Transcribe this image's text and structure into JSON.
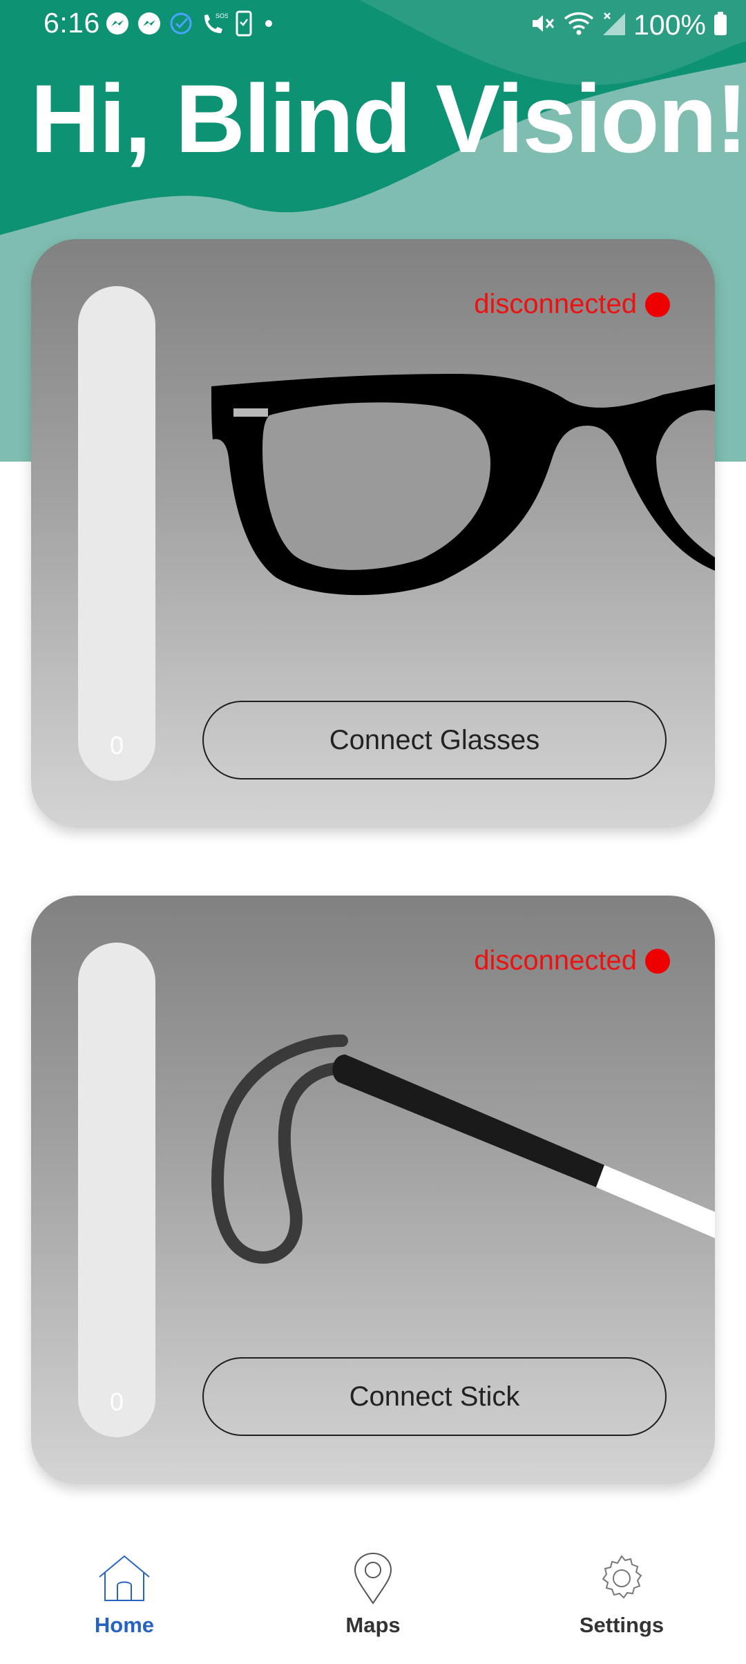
{
  "status_bar": {
    "time": "6:16",
    "battery": "100%"
  },
  "greeting": "Hi, Blind Vision!",
  "devices": [
    {
      "level": "0",
      "status": "disconnected",
      "button_label": "Connect Glasses",
      "image": "glasses-icon"
    },
    {
      "level": "0",
      "status": "disconnected",
      "button_label": "Connect Stick",
      "image": "white-cane-icon"
    }
  ],
  "nav": {
    "items": [
      {
        "label": "Home",
        "icon": "home-icon",
        "active": true
      },
      {
        "label": "Maps",
        "icon": "map-pin-icon",
        "active": false
      },
      {
        "label": "Settings",
        "icon": "gear-icon",
        "active": false
      }
    ]
  },
  "colors": {
    "header_green": "#0e9274",
    "header_wave": "#7ebdb0",
    "status_red": "#ee0000",
    "active_blue": "#2563c0"
  }
}
